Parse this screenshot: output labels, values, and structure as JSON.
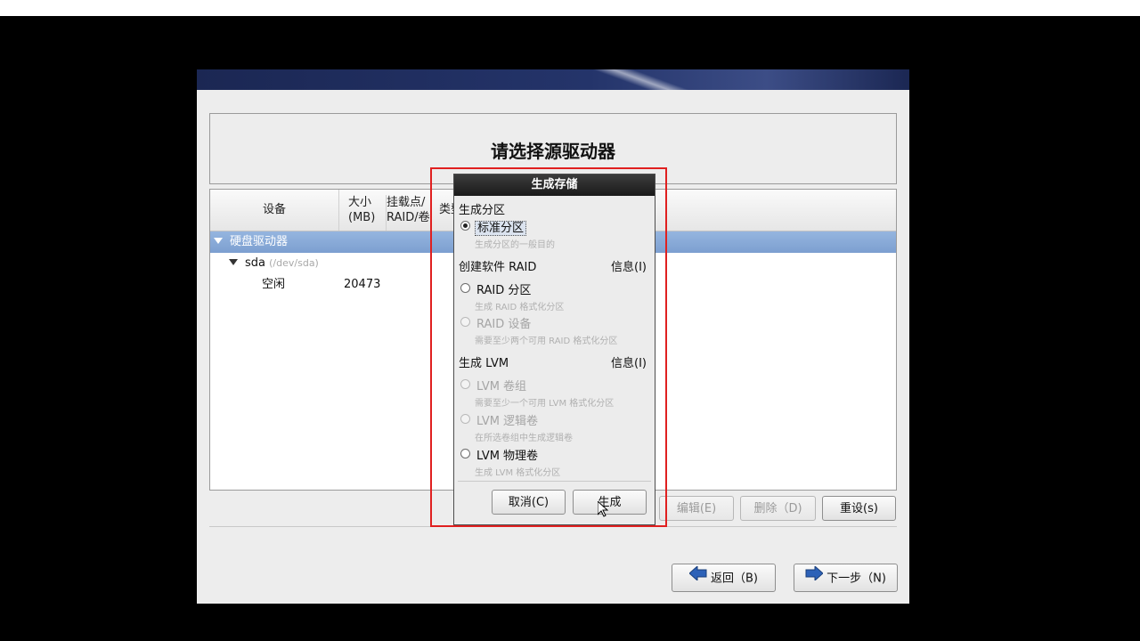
{
  "window": {
    "heading": "请选择源驱动器"
  },
  "table": {
    "headers": {
      "device": "设备",
      "size_line1": "大小",
      "size_line2": "(MB)",
      "mount_line1": "挂载点/",
      "mount_line2": "RAID/卷",
      "type": "类型"
    },
    "rows": {
      "group": "硬盘驱动器",
      "disk_name": "sda",
      "disk_path": "(/dev/sda)",
      "free_label": "空闲",
      "free_size": "20473"
    }
  },
  "buttons": {
    "edit": "编辑(E)",
    "delete": "删除（D)",
    "reset": "重设(s)",
    "back": "返回（B)",
    "next": "下一步（N)"
  },
  "dialog": {
    "title": "生成存储",
    "section_partition": "生成分区",
    "standard_partition": "标准分区",
    "standard_partition_desc": "生成分区的一般目的",
    "section_raid": "创建软件 RAID",
    "raid_info": "信息(I)",
    "raid_partition": "RAID 分区",
    "raid_partition_desc": "生成 RAID 格式化分区",
    "raid_device": "RAID 设备",
    "raid_device_desc": "需要至少两个可用 RAID 格式化分区",
    "section_lvm": "生成 LVM",
    "lvm_info": "信息(I)",
    "lvm_vg": "LVM 卷组",
    "lvm_vg_desc": "需要至少一个可用 LVM 格式化分区",
    "lvm_lv": "LVM 逻辑卷",
    "lvm_lv_desc": "在所选卷组中生成逻辑卷",
    "lvm_pv": "LVM 物理卷",
    "lvm_pv_desc": "生成 LVM 格式化分区",
    "cancel": "取消(C)",
    "create": "生成"
  },
  "colors": {
    "selection": "#7c9fd0",
    "highlight_border": "#e02020",
    "dialog_title_bg": "#1a1a1a"
  }
}
